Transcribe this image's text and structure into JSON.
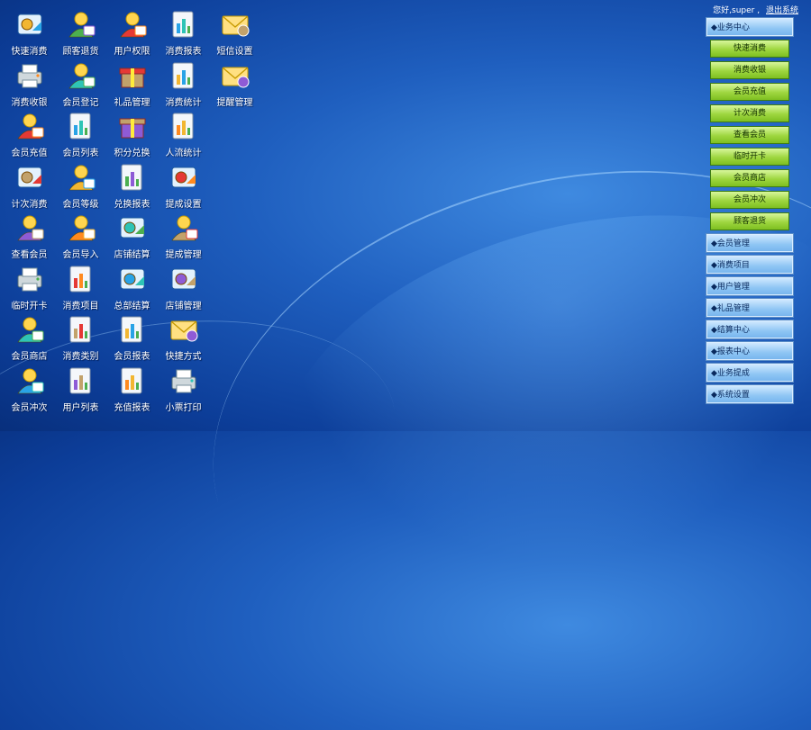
{
  "greeting": {
    "text": "您好,super ,",
    "logout": "退出系统"
  },
  "desktop_icons": [
    {
      "label": "快速消费",
      "icon": "quick-consume-icon"
    },
    {
      "label": "顾客退货",
      "icon": "customer-return-icon"
    },
    {
      "label": "用户权限",
      "icon": "user-permission-icon"
    },
    {
      "label": "消费报表",
      "icon": "consume-report-icon"
    },
    {
      "label": "短信设置",
      "icon": "sms-settings-icon"
    },
    {
      "label": "消费收银",
      "icon": "cashier-icon"
    },
    {
      "label": "会员登记",
      "icon": "member-register-icon"
    },
    {
      "label": "礼品管理",
      "icon": "gift-management-icon"
    },
    {
      "label": "消费统计",
      "icon": "consume-statistics-icon"
    },
    {
      "label": "提醒管理",
      "icon": "reminder-management-icon"
    },
    {
      "label": "会员充值",
      "icon": "member-recharge-icon"
    },
    {
      "label": "会员列表",
      "icon": "member-list-icon"
    },
    {
      "label": "积分兑换",
      "icon": "points-exchange-icon"
    },
    {
      "label": "人流统计",
      "icon": "traffic-statistics-icon"
    },
    {
      "label": "",
      "icon": ""
    },
    {
      "label": "计次消费",
      "icon": "count-consume-icon"
    },
    {
      "label": "会员等级",
      "icon": "member-level-icon"
    },
    {
      "label": "兑换报表",
      "icon": "exchange-report-icon"
    },
    {
      "label": "提成设置",
      "icon": "commission-settings-icon"
    },
    {
      "label": "",
      "icon": ""
    },
    {
      "label": "查看会员",
      "icon": "view-member-icon"
    },
    {
      "label": "会员导入",
      "icon": "member-import-icon"
    },
    {
      "label": "店铺结算",
      "icon": "store-settlement-icon"
    },
    {
      "label": "提成管理",
      "icon": "commission-management-icon"
    },
    {
      "label": "",
      "icon": ""
    },
    {
      "label": "临时开卡",
      "icon": "temp-card-icon"
    },
    {
      "label": "消费项目",
      "icon": "consume-items-icon"
    },
    {
      "label": "总部结算",
      "icon": "hq-settlement-icon"
    },
    {
      "label": "店铺管理",
      "icon": "store-management-icon"
    },
    {
      "label": "",
      "icon": ""
    },
    {
      "label": "会员商店",
      "icon": "member-store-icon"
    },
    {
      "label": "消费类别",
      "icon": "consume-category-icon"
    },
    {
      "label": "会员报表",
      "icon": "member-report-icon"
    },
    {
      "label": "快捷方式",
      "icon": "shortcut-folder-icon"
    },
    {
      "label": "",
      "icon": ""
    },
    {
      "label": "会员冲次",
      "icon": "member-count-recharge-icon"
    },
    {
      "label": "用户列表",
      "icon": "user-list-icon"
    },
    {
      "label": "充值报表",
      "icon": "recharge-report-icon"
    },
    {
      "label": "小票打印",
      "icon": "receipt-printer-icon"
    }
  ],
  "menu": {
    "business_center": "◆业务中心",
    "business_items": [
      "快速消费",
      "消费收银",
      "会员充值",
      "计次消费",
      "查看会员",
      "临时开卡",
      "会员商店",
      "会员冲次",
      "顾客退货"
    ],
    "sections": [
      "◆会员管理",
      "◆消费项目",
      "◆用户管理",
      "◆礼品管理",
      "◆结算中心",
      "◆报表中心",
      "◆业务提成",
      "◆系统设置"
    ]
  }
}
